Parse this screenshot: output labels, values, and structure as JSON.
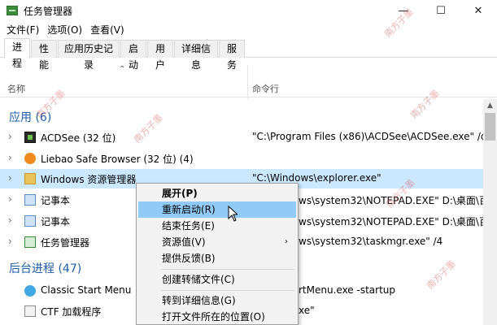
{
  "window": {
    "title": "任务管理器",
    "minimize": "—",
    "maximize": "☐",
    "close": "✕"
  },
  "menu": [
    "文件(F)",
    "选项(O)",
    "查看(V)"
  ],
  "tabs": [
    "进程",
    "性能",
    "应用历史记录",
    "启动",
    "用户",
    "详细信息",
    "服务"
  ],
  "columns": {
    "name": "名称",
    "command": "命令行"
  },
  "groups": {
    "apps": "应用 (6)",
    "background": "后台进程 (47)"
  },
  "rows": [
    {
      "name": "ACDSee (32 位)",
      "cmd": "\"C:\\Program Files (x86)\\ACDSee\\ACDSee.exe\" /dde",
      "icon": "acdsee-icon"
    },
    {
      "name": "Liebao Safe Browser (32 位) (4)",
      "cmd": "",
      "icon": "liebao-icon"
    },
    {
      "name": "Windows 资源管理器",
      "cmd": "\"C:\\Windows\\explorer.exe\"",
      "icon": "folder-icon"
    },
    {
      "name": "记事本",
      "cmd": "ws\\system32\\NOTEPAD.EXE\" D:\\桌面\\百度经",
      "icon": "notepad-icon"
    },
    {
      "name": "记事本",
      "cmd": "ws\\system32\\NOTEPAD.EXE\" D:\\桌面\\百度经",
      "icon": "notepad-icon"
    },
    {
      "name": "任务管理器",
      "cmd": "ws\\system32\\taskmgr.exe\" /4",
      "icon": "taskmgr-icon"
    }
  ],
  "bg_rows": [
    {
      "name": "Classic Start Menu",
      "cmd": "rtMenu.exe -startup",
      "icon": "start-menu-icon"
    },
    {
      "name": "CTF 加载程序",
      "cmd": "xe\"",
      "icon": "ctf-icon"
    }
  ],
  "context_menu": {
    "items": [
      "展开(P)",
      "重新启动(R)",
      "结束任务(E)",
      "资源值(V)",
      "提供反馈(B)",
      "创建转储文件(C)",
      "转到详细信息(G)",
      "打开文件所在的位置(O)"
    ]
  },
  "watermark": "南方子墨"
}
